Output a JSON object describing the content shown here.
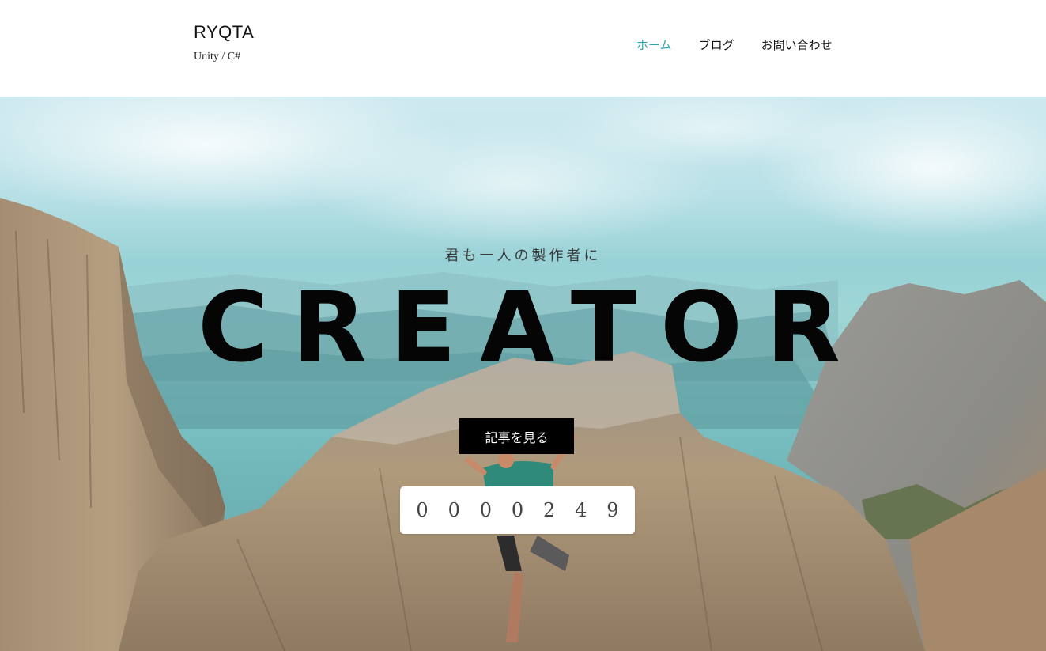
{
  "header": {
    "site_title": "RYQTA",
    "tagline": "Unity / C#",
    "nav": [
      {
        "label": "ホーム",
        "active": true
      },
      {
        "label": "ブログ",
        "active": false
      },
      {
        "label": "お問い合わせ",
        "active": false
      }
    ]
  },
  "hero": {
    "subtitle": "君も一人の製作者に",
    "headline": "CREATOR",
    "cta_label": "記事を見る",
    "counter_digits": [
      "0",
      "0",
      "0",
      "0",
      "2",
      "4",
      "9"
    ]
  },
  "colors": {
    "accent": "#2fa3b3",
    "cta_background": "#000000",
    "headline": "#050505"
  },
  "icons": []
}
